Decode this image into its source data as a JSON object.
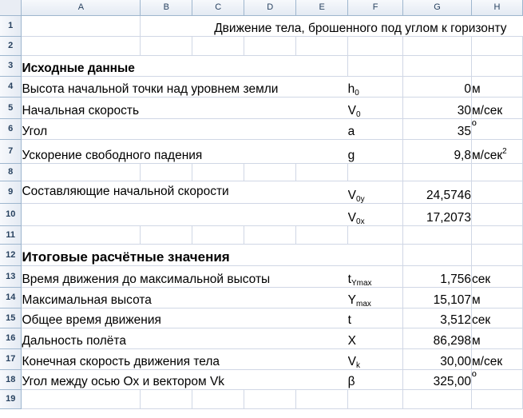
{
  "columns": [
    "A",
    "B",
    "C",
    "D",
    "E",
    "F",
    "G",
    "H"
  ],
  "rows": [
    "1",
    "2",
    "3",
    "4",
    "5",
    "6",
    "7",
    "8",
    "9",
    "10",
    "11",
    "12",
    "13",
    "14",
    "15",
    "16",
    "17",
    "18",
    "19"
  ],
  "title": "Движение тела, брошенного под углом к горизонту",
  "inputs": {
    "header": "Исходные данные",
    "items": [
      {
        "label": "Высота начальной точки над уровнем земли",
        "sym": "h",
        "sub": "0",
        "value": "0",
        "unit": "м"
      },
      {
        "label": "Начальная скорость",
        "sym": "V",
        "sub": "0",
        "value": "30",
        "unit": "м/сек"
      },
      {
        "label": "Угол",
        "sym": "a",
        "sub": "",
        "value": "35",
        "unit": "º"
      },
      {
        "label": "Ускорение свободного падения",
        "sym": "g",
        "sub": "",
        "value": "9,8",
        "unit": "м/сек",
        "unit_sup": "2"
      }
    ]
  },
  "components": {
    "label": "Составляющие начальной скорости",
    "items": [
      {
        "sym": "V",
        "sub": "0y",
        "value": "24,5746"
      },
      {
        "sym": "V",
        "sub": "0x",
        "value": "17,2073"
      }
    ]
  },
  "results": {
    "header": "Итоговые расчётные значения",
    "items": [
      {
        "label": "Время движения до максимальной высоты",
        "sym": "t",
        "sub": "Ymax",
        "value": "1,756",
        "unit": "сек"
      },
      {
        "label": "Максимальная высота",
        "sym": "Y",
        "sub": "max",
        "value": "15,107",
        "unit": "м"
      },
      {
        "label": "Общее время движения",
        "sym": "t",
        "sub": "",
        "value": "3,512",
        "unit": "сек"
      },
      {
        "label": "Дальность полёта",
        "sym": "X",
        "sub": "",
        "value": "86,298",
        "unit": "м"
      },
      {
        "label": "Конечная скорость движения тела",
        "sym": "V",
        "sub": "k",
        "value": "30,00",
        "unit": "м/сек"
      },
      {
        "label": "Угол между осью Ox и вектором Vk",
        "sym": "β",
        "sub": "",
        "value": "325,00",
        "unit": "º"
      }
    ]
  }
}
